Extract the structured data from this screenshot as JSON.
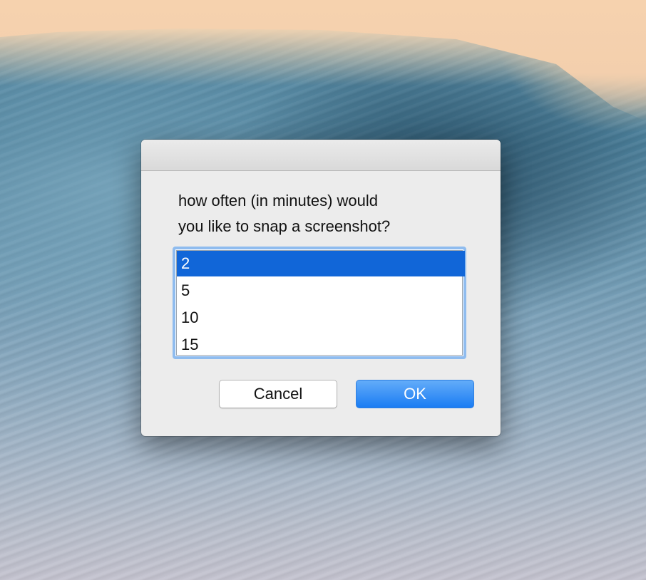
{
  "dialog": {
    "prompt": "how often (in minutes) would\nyou like to snap a screenshot?",
    "options": [
      "2",
      "5",
      "10",
      "15"
    ],
    "selected_index": 0,
    "cancel_label": "Cancel",
    "ok_label": "OK"
  },
  "colors": {
    "selection": "#1166d8",
    "default_button": "#1a7cf3",
    "focus_ring": "#8fbcef"
  }
}
